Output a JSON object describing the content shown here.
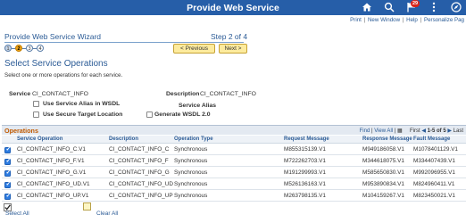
{
  "header": {
    "title": "Provide Web Service",
    "notification_count": "29",
    "icons": [
      "home-icon",
      "search-icon",
      "flag-icon",
      "more-icon",
      "compass-icon"
    ],
    "accent": "#265ea8"
  },
  "top_links": [
    "Print",
    "New Window",
    "Help",
    "Personalize Pag"
  ],
  "wizard": {
    "title": "Provide Web Service Wizard",
    "step_label": "Step 2 of 4",
    "steps": [
      "1",
      "2",
      "3",
      "4"
    ],
    "active_step": "2",
    "prev_label": "< Previous",
    "next_label": "Next >"
  },
  "page": {
    "title": "Select Service Operations",
    "instructions": "Select one or more operations for each service."
  },
  "service": {
    "service_label": "Service",
    "service_value": "CI_CONTACT_INFO",
    "description_label": "Description",
    "description_value": "CI_CONTACT_INFO",
    "alias_wsdl_label": "Use Service Alias in WSDL",
    "service_alias_label": "Service Alias",
    "secure_target_label": "Use Secure Target Location",
    "generate_wsdl_label": "Generate WSDL 2.0"
  },
  "grid": {
    "title": "Operations",
    "nav": {
      "find": "Find",
      "view_all": "View All",
      "first": "First",
      "range": "1-5 of 5",
      "last": "Last"
    },
    "columns": [
      "Service Operation",
      "Description",
      "Operation Type",
      "Request Message",
      "Response Message",
      "Fault Message"
    ],
    "rows": [
      {
        "op": "CI_CONTACT_INFO_C.V1",
        "desc": "CI_CONTACT_INFO_C",
        "type": "Synchronous",
        "req": "M855315139.V1",
        "resp": "M949186058.V1",
        "fault": "M1078401129.V1"
      },
      {
        "op": "CI_CONTACT_INFO_F.V1",
        "desc": "CI_CONTACT_INFO_F",
        "type": "Synchronous",
        "req": "M722262703.V1",
        "resp": "M344618075.V1",
        "fault": "M334407439.V1"
      },
      {
        "op": "CI_CONTACT_INFO_G.V1",
        "desc": "CI_CONTACT_INFO_G",
        "type": "Synchronous",
        "req": "M191299993.V1",
        "resp": "M585650830.V1",
        "fault": "M992096955.V1"
      },
      {
        "op": "CI_CONTACT_INFO_UD.V1",
        "desc": "CI_CONTACT_INFO_UD",
        "type": "Synchronous",
        "req": "M526136163.V1",
        "resp": "M953890834.V1",
        "fault": "M824960411.V1"
      },
      {
        "op": "CI_CONTACT_INFO_UP.V1",
        "desc": "CI_CONTACT_INFO_UP",
        "type": "Synchronous",
        "req": "M263798135.V1",
        "resp": "M104159267.V1",
        "fault": "M823450021.V1"
      }
    ]
  },
  "footer": {
    "select_all": "Select All",
    "clear_all": "Clear All"
  }
}
